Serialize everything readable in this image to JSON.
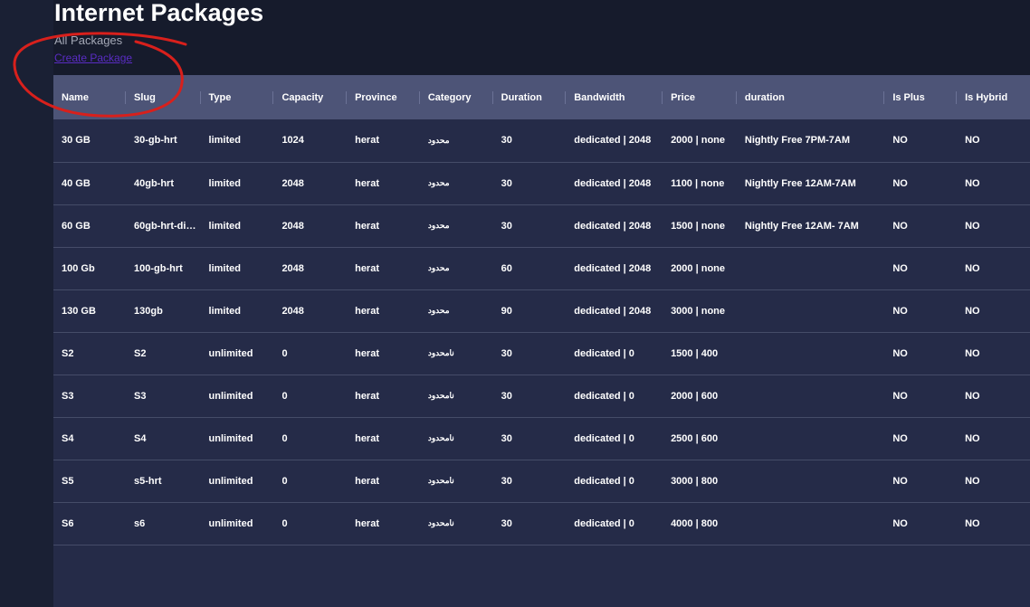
{
  "page": {
    "title": "Internet Packages",
    "subtitle": "All Packages",
    "create_link": "Create Package"
  },
  "table": {
    "columns": [
      "Name",
      "Slug",
      "Type",
      "Capacity",
      "Province",
      "Category",
      "Duration",
      "Bandwidth",
      "Price",
      "duration",
      "Is Plus",
      "Is Hybrid"
    ],
    "rows": [
      {
        "name": "30 GB",
        "slug": "30-gb-hrt",
        "type": "limited",
        "capacity": "1024",
        "province": "herat",
        "category": "محدود",
        "duration": "30",
        "bandwidth": "dedicated | 2048",
        "price": "2000 | none",
        "duration_note": "Nightly Free 7PM-7AM",
        "is_plus": "NO",
        "is_hybrid": "NO"
      },
      {
        "name": "40 GB",
        "slug": "40gb-hrt",
        "type": "limited",
        "capacity": "2048",
        "province": "herat",
        "category": "محدود",
        "duration": "30",
        "bandwidth": "dedicated | 2048",
        "price": "1100 | none",
        "duration_note": "Nightly Free 12AM-7AM",
        "is_plus": "NO",
        "is_hybrid": "NO"
      },
      {
        "name": "60 GB",
        "slug": "60gb-hrt-di…",
        "type": "limited",
        "capacity": "2048",
        "province": "herat",
        "category": "محدود",
        "duration": "30",
        "bandwidth": "dedicated | 2048",
        "price": "1500 | none",
        "duration_note": "Nightly Free 12AM- 7AM",
        "is_plus": "NO",
        "is_hybrid": "NO"
      },
      {
        "name": "100 Gb",
        "slug": "100-gb-hrt",
        "type": "limited",
        "capacity": "2048",
        "province": "herat",
        "category": "محدود",
        "duration": "60",
        "bandwidth": "dedicated | 2048",
        "price": "2000 | none",
        "duration_note": "",
        "is_plus": "NO",
        "is_hybrid": "NO"
      },
      {
        "name": "130 GB",
        "slug": "130gb",
        "type": "limited",
        "capacity": "2048",
        "province": "herat",
        "category": "محدود",
        "duration": "90",
        "bandwidth": "dedicated | 2048",
        "price": "3000 | none",
        "duration_note": "",
        "is_plus": "NO",
        "is_hybrid": "NO"
      },
      {
        "name": "S2",
        "slug": "S2",
        "type": "unlimited",
        "capacity": "0",
        "province": "herat",
        "category": "نامحدود",
        "duration": "30",
        "bandwidth": "dedicated | 0",
        "price": "1500 | 400",
        "duration_note": "",
        "is_plus": "NO",
        "is_hybrid": "NO"
      },
      {
        "name": "S3",
        "slug": "S3",
        "type": "unlimited",
        "capacity": "0",
        "province": "herat",
        "category": "نامحدود",
        "duration": "30",
        "bandwidth": "dedicated | 0",
        "price": "2000 | 600",
        "duration_note": "",
        "is_plus": "NO",
        "is_hybrid": "NO"
      },
      {
        "name": "S4",
        "slug": "S4",
        "type": "unlimited",
        "capacity": "0",
        "province": "herat",
        "category": "نامحدود",
        "duration": "30",
        "bandwidth": "dedicated | 0",
        "price": "2500 | 600",
        "duration_note": "",
        "is_plus": "NO",
        "is_hybrid": "NO"
      },
      {
        "name": "S5",
        "slug": "s5-hrt",
        "type": "unlimited",
        "capacity": "0",
        "province": "herat",
        "category": "نامحدود",
        "duration": "30",
        "bandwidth": "dedicated | 0",
        "price": "3000 | 800",
        "duration_note": "",
        "is_plus": "NO",
        "is_hybrid": "NO"
      },
      {
        "name": "S6",
        "slug": "s6",
        "type": "unlimited",
        "capacity": "0",
        "province": "herat",
        "category": "نامحدود",
        "duration": "30",
        "bandwidth": "dedicated | 0",
        "price": "4000 | 800",
        "duration_note": "",
        "is_plus": "NO",
        "is_hybrid": "NO"
      }
    ]
  },
  "colors": {
    "background": "#161b2c",
    "table_background": "#252b48",
    "header_background": "#4d5477",
    "link": "#5a2cc4",
    "annotation": "#d8201c"
  }
}
